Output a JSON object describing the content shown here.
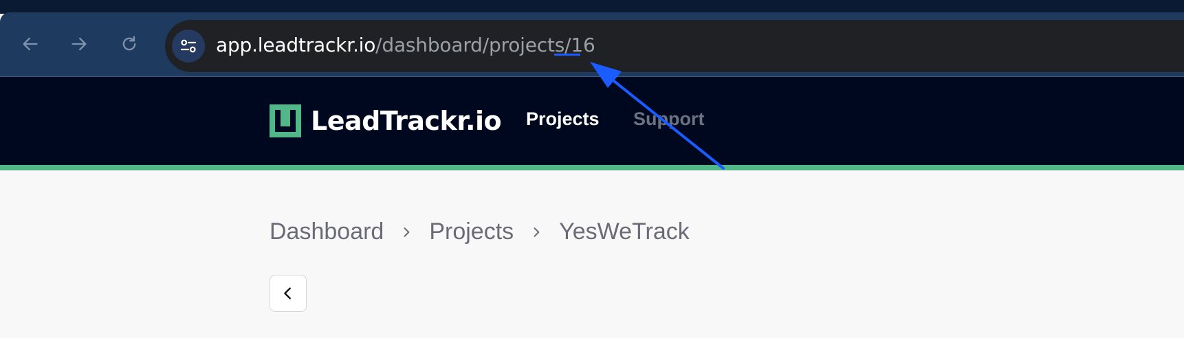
{
  "browser": {
    "url_host": "app.leadtrackr.io",
    "url_path": "/dashboard/projects/",
    "url_id": "16",
    "icons": {
      "back": "arrow-left-icon",
      "forward": "arrow-right-icon",
      "reload": "reload-icon",
      "site_settings": "tune-icon"
    }
  },
  "header": {
    "brand_name": "LeadTrackr.io",
    "nav": [
      {
        "label": "Projects",
        "active": true
      },
      {
        "label": "Support",
        "active": false
      }
    ]
  },
  "breadcrumb": {
    "items": [
      "Dashboard",
      "Projects",
      "YesWeTrack"
    ]
  },
  "colors": {
    "chrome": "#1e3a5f",
    "app_header": "#000820",
    "accent": "#52b788",
    "annotation": "#1a5cff"
  }
}
